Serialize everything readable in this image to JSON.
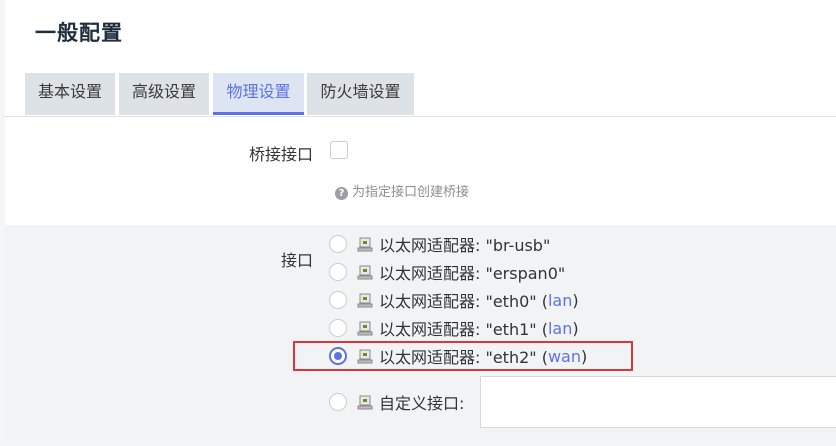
{
  "header": {
    "title": "一般配置"
  },
  "tabs": [
    {
      "label": "基本设置"
    },
    {
      "label": "高级设置"
    },
    {
      "label": "物理设置"
    },
    {
      "label": "防火墙设置"
    }
  ],
  "bridge": {
    "label": "桥接接口",
    "hint": "为指定接口创建桥接"
  },
  "interface": {
    "label": "接口",
    "options": [
      {
        "prefix": "以太网适配器: \"br-usb\"",
        "zone": ""
      },
      {
        "prefix": "以太网适配器: \"erspan0\"",
        "zone": ""
      },
      {
        "prefix": "以太网适配器: \"eth0\" (",
        "zone": "lan",
        "suffix": ")"
      },
      {
        "prefix": "以太网适配器: \"eth1\" (",
        "zone": "lan",
        "suffix": ")"
      },
      {
        "prefix": "以太网适配器: \"eth2\" (",
        "zone": "wan",
        "suffix": ")"
      }
    ],
    "custom_label": "自定义接口:"
  }
}
